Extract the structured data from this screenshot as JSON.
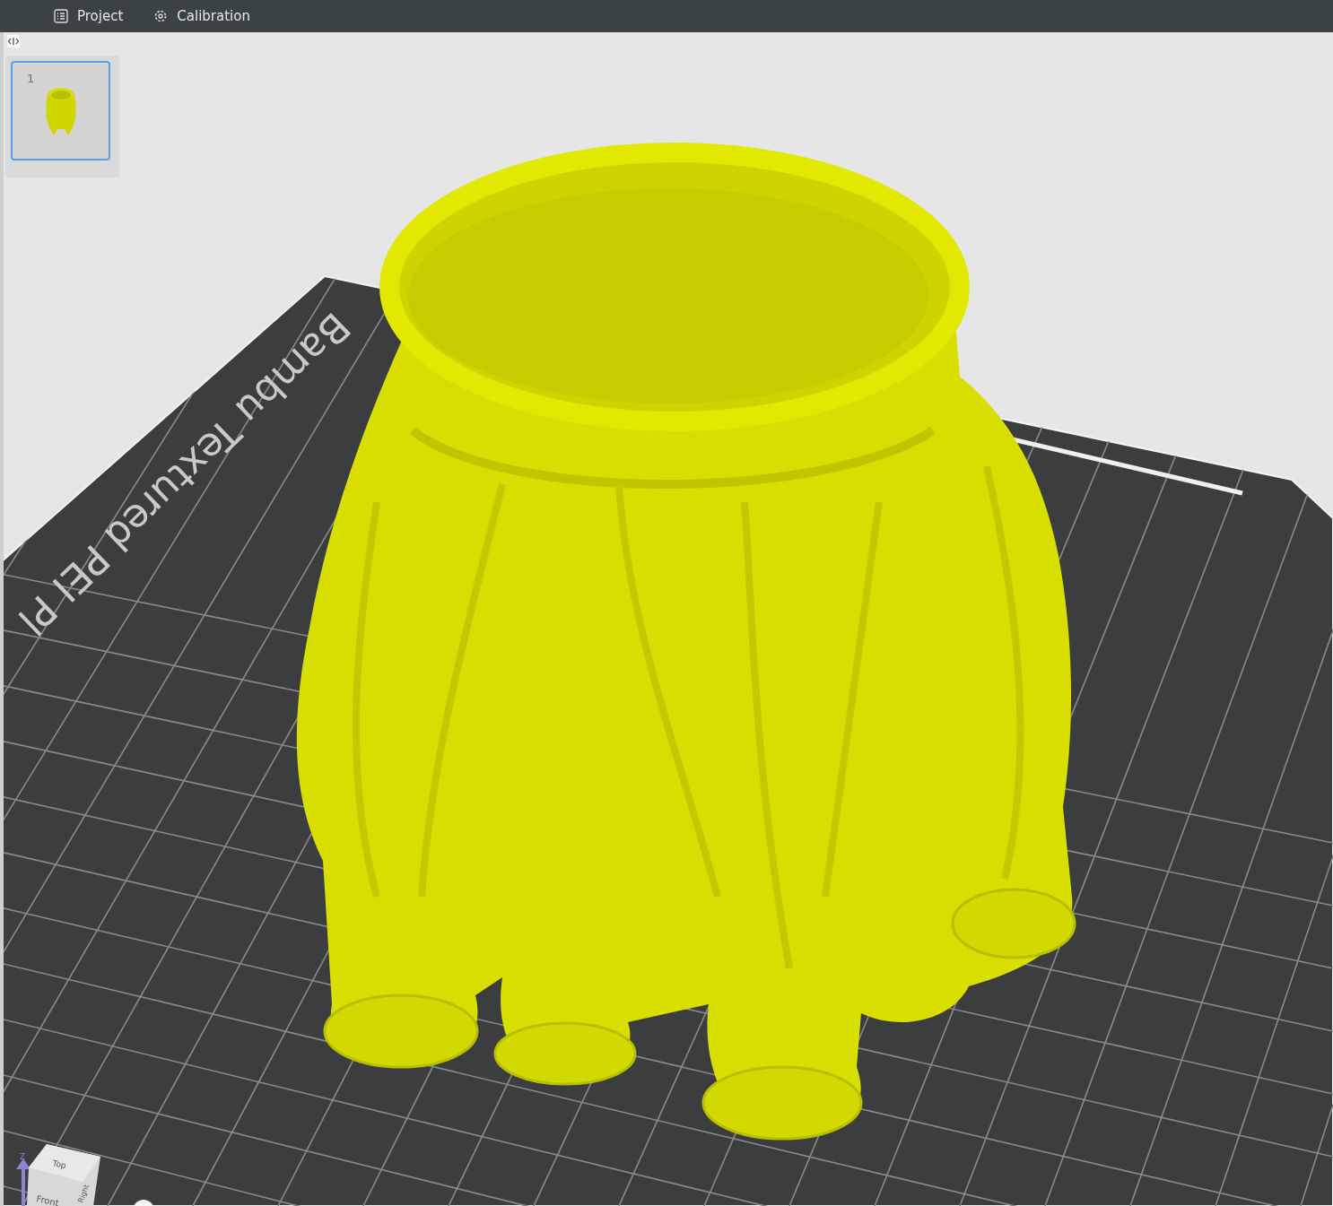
{
  "tabs": [
    {
      "label": "Project",
      "kind": "list"
    },
    {
      "label": "Calibration",
      "kind": "gear"
    }
  ],
  "plates": [
    {
      "number": "1",
      "selected": true
    }
  ],
  "viewport": {
    "plate_label": "Bambu Textured PEI Pl",
    "view_cube": {
      "axis": "Z",
      "faces": [
        "Top",
        "Front",
        "Right"
      ]
    }
  }
}
